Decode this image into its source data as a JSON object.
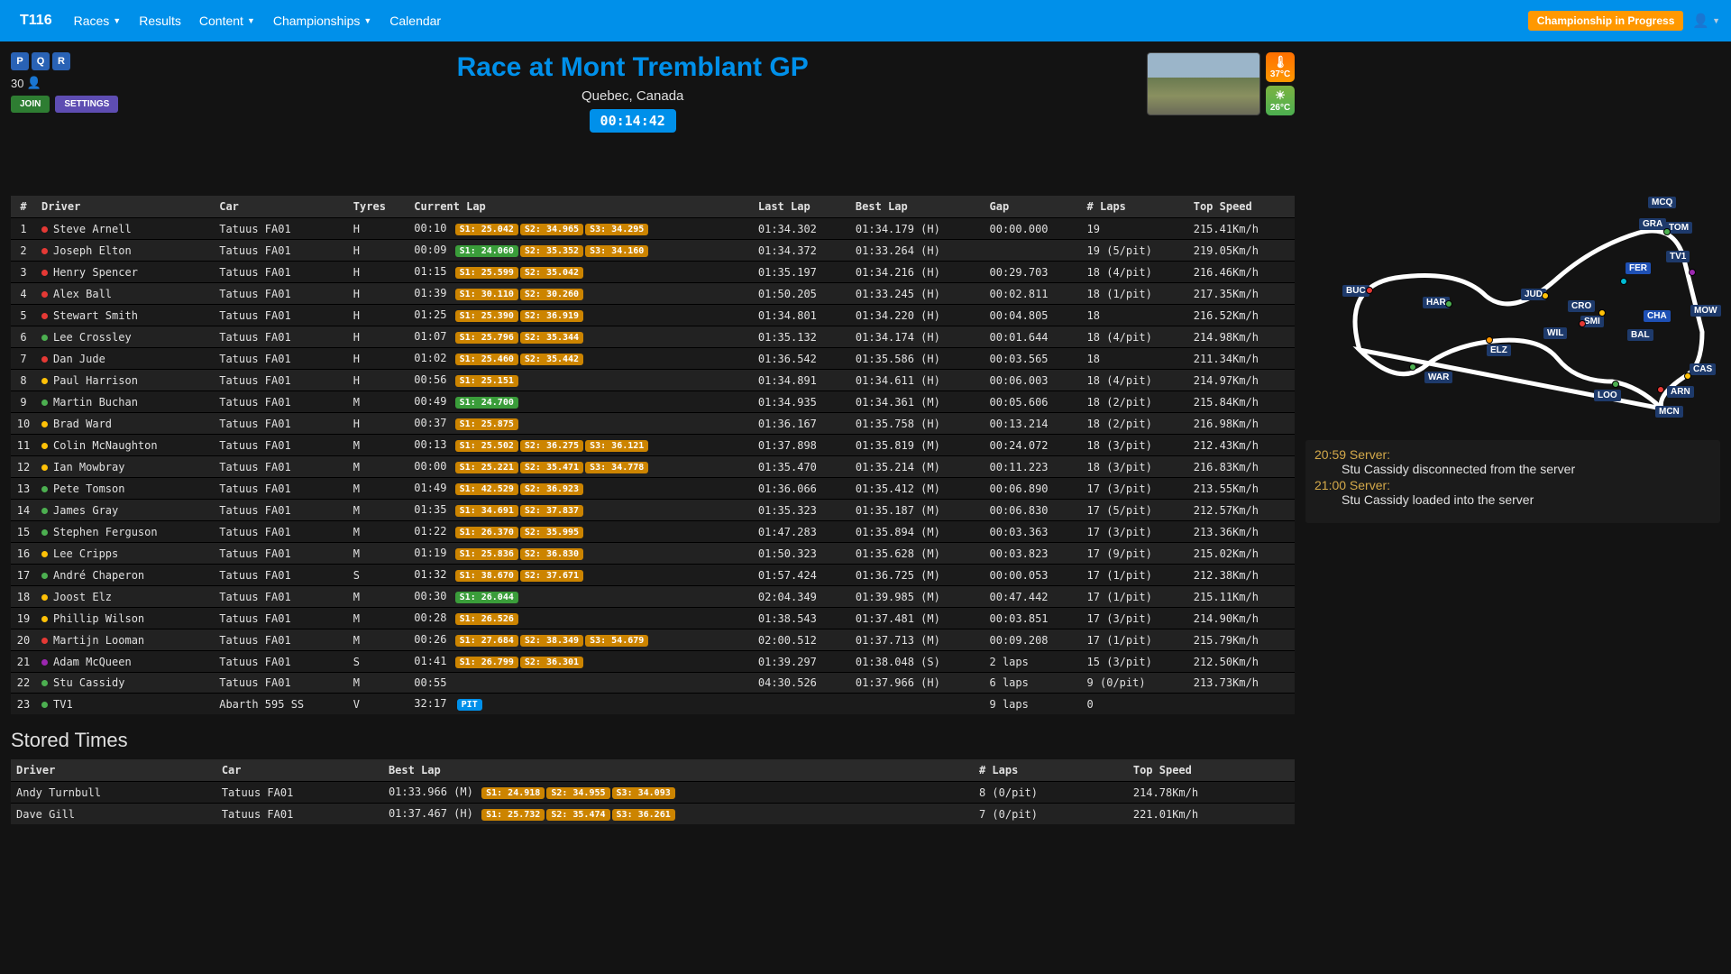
{
  "nav": {
    "brand": "T116",
    "items": [
      "Races",
      "Results",
      "Content",
      "Championships",
      "Calendar"
    ],
    "items_dropdown": [
      true,
      false,
      true,
      true,
      false
    ],
    "badge": "Championship in Progress"
  },
  "header": {
    "pqr": [
      "P",
      "Q",
      "R"
    ],
    "players": "30",
    "title": "Race at Mont Tremblant GP",
    "location": "Quebec, Canada",
    "time": "00:14:42",
    "track_temp": "37°C",
    "air_temp": "26°C",
    "join": "JOIN",
    "settings": "SETTINGS"
  },
  "columns": [
    "#",
    "Driver",
    "Car",
    "Tyres",
    "Current Lap",
    "Last Lap",
    "Best Lap",
    "Gap",
    "# Laps",
    "Top Speed"
  ],
  "rows": [
    {
      "pos": "1",
      "dot": "#e53935",
      "driver": "Steve Arnell",
      "car": "Tatuus FA01",
      "tyres": "H",
      "cl": "00:10",
      "sectors": [
        [
          "S1: 25.042",
          "o"
        ],
        [
          "S2: 34.965",
          "o"
        ],
        [
          "S3: 34.295",
          "o"
        ]
      ],
      "last": "01:34.302",
      "best": "01:34.179 (H)",
      "gap": "00:00.000",
      "laps": "19",
      "speed": "215.41Km/h"
    },
    {
      "pos": "2",
      "dot": "#e53935",
      "driver": "Joseph Elton",
      "car": "Tatuus FA01",
      "tyres": "H",
      "cl": "00:09",
      "sectors": [
        [
          "S1: 24.060",
          "g"
        ],
        [
          "S2: 35.352",
          "o"
        ],
        [
          "S3: 34.160",
          "o"
        ]
      ],
      "last": "01:34.372",
      "best": "01:33.264 (H)",
      "gap": "",
      "laps": "19 (5/pit)",
      "speed": "219.05Km/h"
    },
    {
      "pos": "3",
      "dot": "#e53935",
      "driver": "Henry Spencer",
      "car": "Tatuus FA01",
      "tyres": "H",
      "cl": "01:15",
      "sectors": [
        [
          "S1: 25.599",
          "o"
        ],
        [
          "S2: 35.042",
          "o"
        ]
      ],
      "last": "01:35.197",
      "best": "01:34.216 (H)",
      "gap": "00:29.703",
      "laps": "18 (4/pit)",
      "speed": "216.46Km/h"
    },
    {
      "pos": "4",
      "dot": "#e53935",
      "driver": "Alex Ball",
      "car": "Tatuus FA01",
      "tyres": "H",
      "cl": "01:39",
      "sectors": [
        [
          "S1: 30.110",
          "o"
        ],
        [
          "S2: 30.260",
          "o"
        ]
      ],
      "last": "01:50.205",
      "best": "01:33.245 (H)",
      "gap": "00:02.811",
      "laps": "18 (1/pit)",
      "speed": "217.35Km/h"
    },
    {
      "pos": "5",
      "dot": "#e53935",
      "driver": "Stewart Smith",
      "car": "Tatuus FA01",
      "tyres": "H",
      "cl": "01:25",
      "sectors": [
        [
          "S1: 25.390",
          "o"
        ],
        [
          "S2: 36.919",
          "o"
        ]
      ],
      "last": "01:34.801",
      "best": "01:34.220 (H)",
      "gap": "00:04.805",
      "laps": "18",
      "speed": "216.52Km/h"
    },
    {
      "pos": "6",
      "dot": "#4caf50",
      "driver": "Lee Crossley",
      "car": "Tatuus FA01",
      "tyres": "H",
      "cl": "01:07",
      "sectors": [
        [
          "S1: 25.796",
          "o"
        ],
        [
          "S2: 35.344",
          "o"
        ]
      ],
      "last": "01:35.132",
      "best": "01:34.174 (H)",
      "gap": "00:01.644",
      "laps": "18 (4/pit)",
      "speed": "214.98Km/h"
    },
    {
      "pos": "7",
      "dot": "#e53935",
      "driver": "Dan Jude",
      "car": "Tatuus FA01",
      "tyres": "H",
      "cl": "01:02",
      "sectors": [
        [
          "S1: 25.460",
          "o"
        ],
        [
          "S2: 35.442",
          "o"
        ]
      ],
      "last": "01:36.542",
      "best": "01:35.586 (H)",
      "gap": "00:03.565",
      "laps": "18",
      "speed": "211.34Km/h"
    },
    {
      "pos": "8",
      "dot": "#ffc107",
      "driver": "Paul Harrison",
      "car": "Tatuus FA01",
      "tyres": "H",
      "cl": "00:56",
      "sectors": [
        [
          "S1: 25.151",
          "o"
        ]
      ],
      "last": "01:34.891",
      "best": "01:34.611 (H)",
      "gap": "00:06.003",
      "laps": "18 (4/pit)",
      "speed": "214.97Km/h"
    },
    {
      "pos": "9",
      "dot": "#4caf50",
      "driver": "Martin Buchan",
      "car": "Tatuus FA01",
      "tyres": "M",
      "cl": "00:49",
      "sectors": [
        [
          "S1: 24.700",
          "g"
        ]
      ],
      "last": "01:34.935",
      "best": "01:34.361 (M)",
      "gap": "00:05.606",
      "laps": "18 (2/pit)",
      "speed": "215.84Km/h"
    },
    {
      "pos": "10",
      "dot": "#ffc107",
      "driver": "Brad Ward",
      "car": "Tatuus FA01",
      "tyres": "H",
      "cl": "00:37",
      "sectors": [
        [
          "S1: 25.875",
          "o"
        ]
      ],
      "last": "01:36.167",
      "best": "01:35.758 (H)",
      "gap": "00:13.214",
      "laps": "18 (2/pit)",
      "speed": "216.98Km/h"
    },
    {
      "pos": "11",
      "dot": "#ffc107",
      "driver": "Colin McNaughton",
      "car": "Tatuus FA01",
      "tyres": "M",
      "cl": "00:13",
      "sectors": [
        [
          "S1: 25.502",
          "o"
        ],
        [
          "S2: 36.275",
          "o"
        ],
        [
          "S3: 36.121",
          "o"
        ]
      ],
      "last": "01:37.898",
      "best": "01:35.819 (M)",
      "gap": "00:24.072",
      "laps": "18 (3/pit)",
      "speed": "212.43Km/h"
    },
    {
      "pos": "12",
      "dot": "#ffc107",
      "driver": "Ian Mowbray",
      "car": "Tatuus FA01",
      "tyres": "M",
      "cl": "00:00",
      "sectors": [
        [
          "S1: 25.221",
          "o"
        ],
        [
          "S2: 35.471",
          "o"
        ],
        [
          "S3: 34.778",
          "o"
        ]
      ],
      "last": "01:35.470",
      "best": "01:35.214 (M)",
      "gap": "00:11.223",
      "laps": "18 (3/pit)",
      "speed": "216.83Km/h"
    },
    {
      "pos": "13",
      "dot": "#4caf50",
      "driver": "Pete Tomson",
      "car": "Tatuus FA01",
      "tyres": "M",
      "cl": "01:49",
      "sectors": [
        [
          "S1: 42.529",
          "o"
        ],
        [
          "S2: 36.923",
          "o"
        ]
      ],
      "last": "01:36.066",
      "best": "01:35.412 (M)",
      "gap": "00:06.890",
      "laps": "17 (3/pit)",
      "speed": "213.55Km/h"
    },
    {
      "pos": "14",
      "dot": "#4caf50",
      "driver": "James Gray",
      "car": "Tatuus FA01",
      "tyres": "M",
      "cl": "01:35",
      "sectors": [
        [
          "S1: 34.691",
          "o"
        ],
        [
          "S2: 37.837",
          "o"
        ]
      ],
      "last": "01:35.323",
      "best": "01:35.187 (M)",
      "gap": "00:06.830",
      "laps": "17 (5/pit)",
      "speed": "212.57Km/h"
    },
    {
      "pos": "15",
      "dot": "#4caf50",
      "driver": "Stephen Ferguson",
      "car": "Tatuus FA01",
      "tyres": "M",
      "cl": "01:22",
      "sectors": [
        [
          "S1: 26.370",
          "o"
        ],
        [
          "S2: 35.995",
          "o"
        ]
      ],
      "last": "01:47.283",
      "best": "01:35.894 (M)",
      "gap": "00:03.363",
      "laps": "17 (3/pit)",
      "speed": "213.36Km/h"
    },
    {
      "pos": "16",
      "dot": "#ffc107",
      "driver": "Lee Cripps",
      "car": "Tatuus FA01",
      "tyres": "M",
      "cl": "01:19",
      "sectors": [
        [
          "S1: 25.836",
          "o"
        ],
        [
          "S2: 36.830",
          "o"
        ]
      ],
      "last": "01:50.323",
      "best": "01:35.628 (M)",
      "gap": "00:03.823",
      "laps": "17 (9/pit)",
      "speed": "215.02Km/h"
    },
    {
      "pos": "17",
      "dot": "#4caf50",
      "driver": "André Chaperon",
      "car": "Tatuus FA01",
      "tyres": "S",
      "cl": "01:32",
      "sectors": [
        [
          "S1: 38.670",
          "o"
        ],
        [
          "S2: 37.671",
          "o"
        ]
      ],
      "last": "01:57.424",
      "best": "01:36.725 (M)",
      "gap": "00:00.053",
      "laps": "17 (1/pit)",
      "speed": "212.38Km/h"
    },
    {
      "pos": "18",
      "dot": "#ffc107",
      "driver": "Joost Elz",
      "car": "Tatuus FA01",
      "tyres": "M",
      "cl": "00:30",
      "sectors": [
        [
          "S1: 26.044",
          "g"
        ]
      ],
      "last": "02:04.349",
      "best": "01:39.985 (M)",
      "gap": "00:47.442",
      "laps": "17 (1/pit)",
      "speed": "215.11Km/h"
    },
    {
      "pos": "19",
      "dot": "#ffc107",
      "driver": "Phillip Wilson",
      "car": "Tatuus FA01",
      "tyres": "M",
      "cl": "00:28",
      "sectors": [
        [
          "S1: 26.526",
          "o"
        ]
      ],
      "last": "01:38.543",
      "best": "01:37.481 (M)",
      "gap": "00:03.851",
      "laps": "17 (3/pit)",
      "speed": "214.90Km/h"
    },
    {
      "pos": "20",
      "dot": "#e53935",
      "driver": "Martijn Looman",
      "car": "Tatuus FA01",
      "tyres": "M",
      "cl": "00:26",
      "sectors": [
        [
          "S1: 27.684",
          "o"
        ],
        [
          "S2: 38.349",
          "o"
        ],
        [
          "S3: 54.679",
          "o"
        ]
      ],
      "last": "02:00.512",
      "best": "01:37.713 (M)",
      "gap": "00:09.208",
      "laps": "17 (1/pit)",
      "speed": "215.79Km/h"
    },
    {
      "pos": "21",
      "dot": "#9c27b0",
      "driver": "Adam McQueen",
      "car": "Tatuus FA01",
      "tyres": "S",
      "cl": "01:41",
      "sectors": [
        [
          "S1: 26.799",
          "o"
        ],
        [
          "S2: 36.301",
          "o"
        ]
      ],
      "last": "01:39.297",
      "best": "01:38.048 (S)",
      "gap": "2 laps",
      "laps": "15 (3/pit)",
      "speed": "212.50Km/h"
    },
    {
      "pos": "22",
      "dot": "#4caf50",
      "driver": "Stu Cassidy",
      "car": "Tatuus FA01",
      "tyres": "M",
      "cl": "00:55",
      "sectors": [],
      "last": "04:30.526",
      "best": "01:37.966 (H)",
      "gap": "6 laps",
      "laps": "9 (0/pit)",
      "speed": "213.73Km/h"
    },
    {
      "pos": "23",
      "dot": "#4caf50",
      "driver": "TV1",
      "car": "Abarth 595 SS",
      "tyres": "V",
      "cl": "32:17",
      "sectors": [],
      "pit": true,
      "last": "",
      "best": "",
      "gap": "9 laps",
      "laps": "0",
      "speed": ""
    }
  ],
  "stored_title": "Stored Times",
  "stored_columns": [
    "Driver",
    "Car",
    "Best Lap",
    "# Laps",
    "Top Speed"
  ],
  "stored_rows": [
    {
      "driver": "Andy Turnbull",
      "car": "Tatuus FA01",
      "best": "01:33.966 (M)",
      "sectors": [
        [
          "S1: 24.918",
          "o"
        ],
        [
          "S2: 34.955",
          "o"
        ],
        [
          "S3: 34.093",
          "o"
        ]
      ],
      "laps": "8 (0/pit)",
      "speed": "214.78Km/h"
    },
    {
      "driver": "Dave Gill",
      "car": "Tatuus FA01",
      "best": "01:37.467 (H)",
      "sectors": [
        [
          "S1: 25.732",
          "o"
        ],
        [
          "S2: 35.474",
          "o"
        ],
        [
          "S3: 36.261",
          "o"
        ]
      ],
      "laps": "7 (0/pit)",
      "speed": "221.01Km/h"
    }
  ],
  "map_labels": [
    "MCQ",
    "GRA",
    "TOM",
    "TV1",
    "FER",
    "CHA",
    "MOW",
    "CRO",
    "SMI",
    "JUD",
    "BAL",
    "WIL",
    "ELZ",
    "HAR",
    "BUC",
    "WAR",
    "CAS",
    "ARN",
    "LOO",
    "MCN"
  ],
  "log": [
    {
      "time": "20:59",
      "who": "Server:",
      "msg": "Stu Cassidy disconnected from the server"
    },
    {
      "time": "21:00",
      "who": "Server:",
      "msg": "Stu Cassidy loaded into the server"
    }
  ],
  "pit_label": "PIT"
}
